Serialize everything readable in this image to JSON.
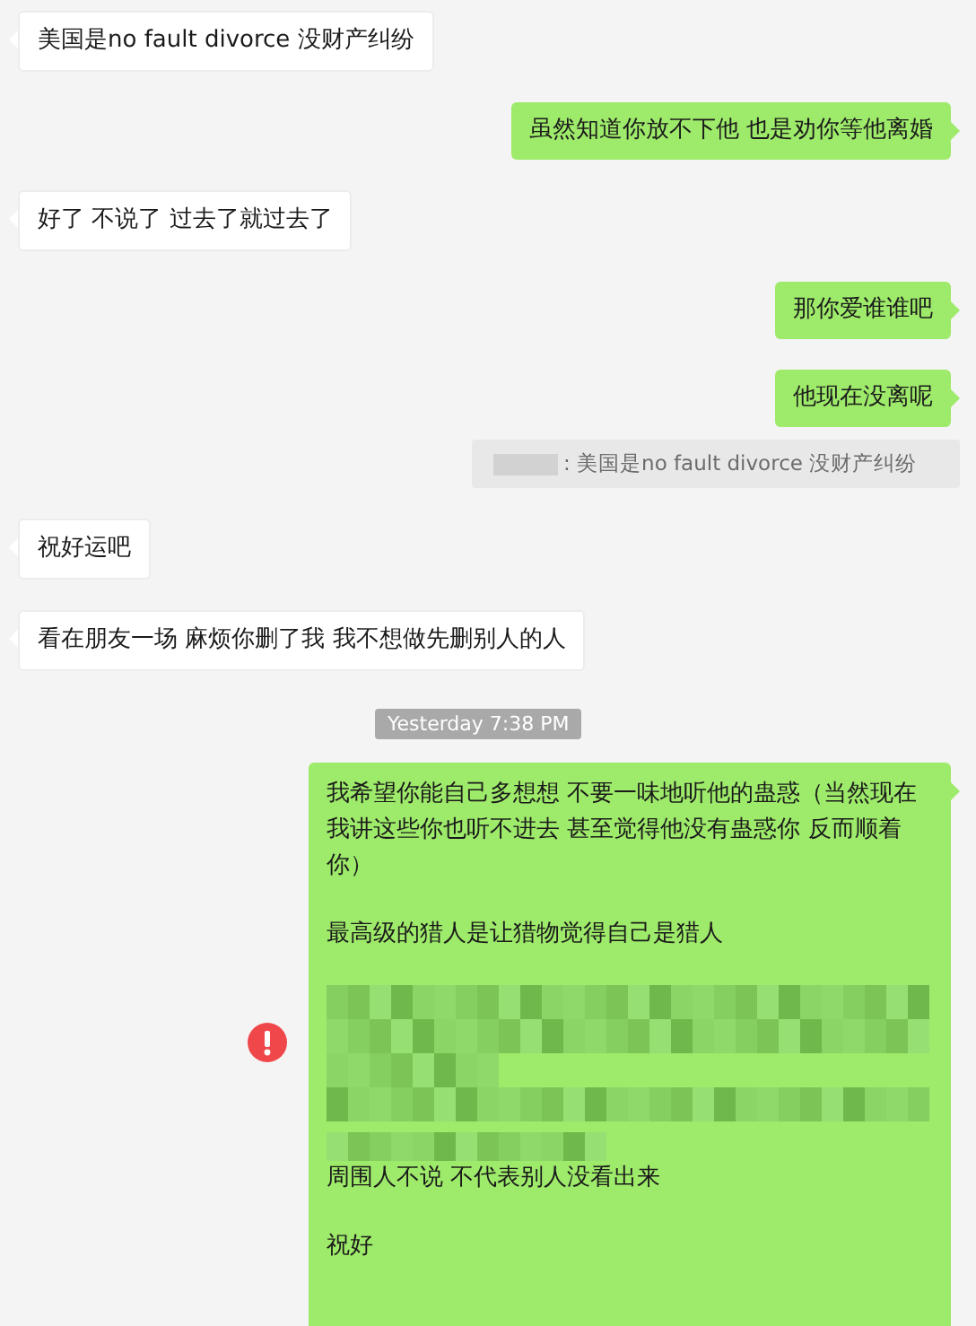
{
  "messages": [
    {
      "kind": "incoming",
      "text": "美国是no fault divorce 没财产纠纷"
    },
    {
      "kind": "outgoing",
      "text": "虽然知道你放不下他 也是劝你等他离婚"
    },
    {
      "kind": "incoming",
      "text": "好了 不说了 过去了就过去了"
    },
    {
      "kind": "outgoing",
      "text": "那你爱谁谁吧"
    },
    {
      "kind": "outgoing",
      "text": "他现在没离呢"
    },
    {
      "kind": "quote",
      "text": ": 美国是no fault divorce 没财产纠纷"
    },
    {
      "kind": "incoming",
      "text": "祝好运吧"
    },
    {
      "kind": "incoming",
      "text": "看在朋友一场 麻烦你删了我 我不想做先删别人的人"
    },
    {
      "kind": "timestamp",
      "text": "Yesterday 7:38 PM"
    },
    {
      "kind": "outgoing",
      "failed": true,
      "paragraphs": [
        {
          "kind": "text",
          "text": "我希望你能自己多想想 不要一味地听他的蛊惑（当然现在我讲这些你也听不进去 甚至觉得他没有蛊惑你 反而顺着你）"
        },
        {
          "kind": "text",
          "text": "最高级的猎人是让猎物觉得自己是猎人"
        },
        {
          "kind": "redacted"
        },
        {
          "kind": "partly_redacted",
          "text": "周围人不说 不代表别人没看出来"
        },
        {
          "kind": "text",
          "text": "祝好"
        }
      ]
    }
  ]
}
